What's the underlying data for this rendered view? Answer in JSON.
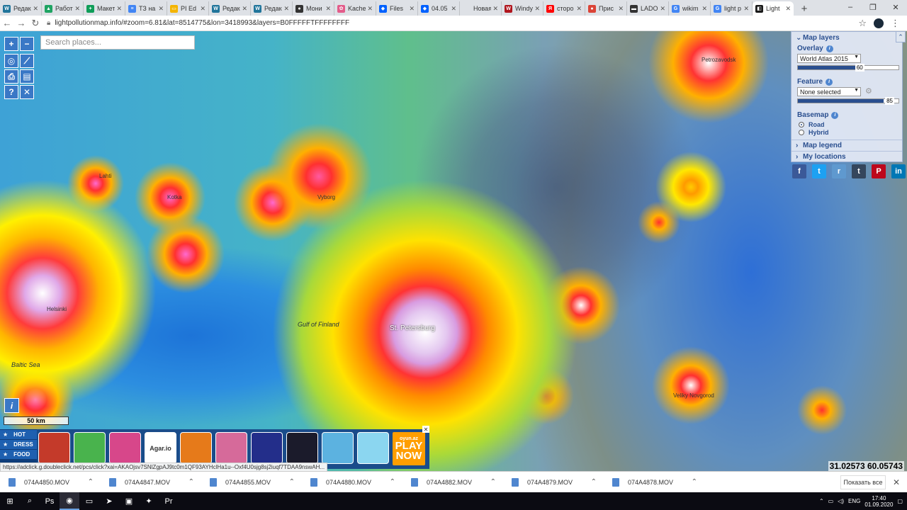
{
  "browser": {
    "tabs": [
      {
        "title": "Редак",
        "icon": "wordpress-icon",
        "color": "#21759b",
        "glyph": "W"
      },
      {
        "title": "Работ",
        "icon": "google-drive-icon",
        "color": "#1fa463",
        "glyph": "▲"
      },
      {
        "title": "Макет",
        "icon": "google-sheets-icon",
        "color": "#0f9d58",
        "glyph": "+"
      },
      {
        "title": "ТЗ на",
        "icon": "google-docs-icon",
        "color": "#4285f4",
        "glyph": "≡"
      },
      {
        "title": "PI Ed",
        "icon": "google-slides-icon",
        "color": "#f4b400",
        "glyph": "▭"
      },
      {
        "title": "Редак",
        "icon": "wordpress-icon",
        "color": "#21759b",
        "glyph": "W"
      },
      {
        "title": "Редак",
        "icon": "wordpress-icon",
        "color": "#21759b",
        "glyph": "W"
      },
      {
        "title": "Мони",
        "icon": "github-icon",
        "color": "#333333",
        "glyph": "●"
      },
      {
        "title": "Kache",
        "icon": "kache-icon",
        "color": "#e35c8a",
        "glyph": "✿"
      },
      {
        "title": "Files",
        "icon": "dropbox-icon",
        "color": "#0061ff",
        "glyph": "◆"
      },
      {
        "title": "04.05",
        "icon": "dropbox-icon",
        "color": "#0061ff",
        "glyph": "◆"
      },
      {
        "title": "Новая вкл",
        "icon": "blank-tab-icon",
        "color": "#dee1e6",
        "glyph": ""
      },
      {
        "title": "Windy",
        "icon": "windy-icon",
        "color": "#b0161e",
        "glyph": "W"
      },
      {
        "title": "сторо",
        "icon": "yandex-icon",
        "color": "#ff0000",
        "glyph": "Я"
      },
      {
        "title": "Прис",
        "icon": "maps-pin-icon",
        "color": "#db4437",
        "glyph": "●"
      },
      {
        "title": "LADO",
        "icon": "car-icon",
        "color": "#333333",
        "glyph": "▬"
      },
      {
        "title": "wikim",
        "icon": "google-icon",
        "color": "#4285f4",
        "glyph": "G"
      },
      {
        "title": "light p",
        "icon": "google-icon",
        "color": "#4285f4",
        "glyph": "G"
      },
      {
        "title": "Light",
        "icon": "lightpollution-icon",
        "color": "#1a1a1a",
        "glyph": "◧",
        "active": true
      }
    ],
    "url": "lightpollutionmap.info/#zoom=6.81&lat=8514775&lon=3418993&layers=B0FFFFFTFFFFFFFF",
    "window_controls": [
      "–",
      "❐",
      "✕"
    ]
  },
  "map": {
    "search_placeholder": "Search places...",
    "controls": [
      {
        "name": "zoom-in-button",
        "glyph": "+"
      },
      {
        "name": "zoom-out-button",
        "glyph": "−"
      },
      {
        "name": "locate-button",
        "glyph": "◎"
      },
      {
        "name": "measure-button",
        "glyph": "⟋"
      },
      {
        "name": "print-button",
        "glyph": "⎙"
      },
      {
        "name": "chart-button",
        "glyph": "▤"
      },
      {
        "name": "help-button",
        "glyph": "?"
      },
      {
        "name": "tools-button",
        "glyph": "✕"
      }
    ],
    "labels": [
      {
        "text": "St. Petersburg",
        "kind": "big"
      },
      {
        "text": "Helsinki",
        "kind": "city"
      },
      {
        "text": "Baltic Sea",
        "kind": "sea"
      },
      {
        "text": "Gulf of Finland",
        "kind": "sea"
      },
      {
        "text": "Vyborg",
        "kind": "city"
      },
      {
        "text": "Kotka",
        "kind": "city"
      },
      {
        "text": "Lahti",
        "kind": "city"
      },
      {
        "text": "Veliky Novgorod",
        "kind": "city"
      },
      {
        "text": "Petrozavodsk",
        "kind": "city"
      }
    ],
    "scale": "50 km",
    "coordinates": "31.02573  60.05743"
  },
  "layers_panel": {
    "title": "Map layers",
    "overlay_label": "Overlay",
    "overlay_value": "World Atlas 2015",
    "overlay_opacity": 60,
    "feature_label": "Feature",
    "feature_value": "None selected",
    "feature_opacity": 85,
    "basemap_label": "Basemap",
    "basemap_options": [
      "Road",
      "Hybrid"
    ],
    "basemap_selected": "Road",
    "map_legend": "Map legend",
    "my_locations": "My locations",
    "social": [
      {
        "name": "facebook-icon",
        "glyph": "f",
        "color": "#3b5998"
      },
      {
        "name": "twitter-icon",
        "glyph": "t",
        "color": "#1da1f2"
      },
      {
        "name": "reddit-icon",
        "glyph": "r",
        "color": "#5f99cf"
      },
      {
        "name": "tumblr-icon",
        "glyph": "t",
        "color": "#35465c"
      },
      {
        "name": "pinterest-icon",
        "glyph": "P",
        "color": "#bd081c"
      },
      {
        "name": "linkedin-icon",
        "glyph": "in",
        "color": "#0077b5"
      }
    ]
  },
  "ad": {
    "categories": [
      "HOT",
      "DRESS",
      "FOOD"
    ],
    "category_icons": [
      "★",
      "★",
      "★"
    ],
    "games": [
      {
        "label": "",
        "color": "#c43a2a"
      },
      {
        "label": "",
        "color": "#49b34d"
      },
      {
        "label": "",
        "color": "#d7478a"
      },
      {
        "label": "Agar.io",
        "color": "#ffffff"
      },
      {
        "label": "",
        "color": "#e67a1a"
      },
      {
        "label": "",
        "color": "#d66a9a"
      },
      {
        "label": "",
        "color": "#232e8a"
      },
      {
        "label": "",
        "color": "#1b1b2b"
      },
      {
        "label": "",
        "color": "#5cb2e0"
      },
      {
        "label": "",
        "color": "#8bd6f0"
      }
    ],
    "play_brand": "oyun.az",
    "play_text": "PLAY NOW",
    "close": "✕"
  },
  "status_url": "https://adclick.g.doubleclick.net/pcs/click?xai=AKAOjsv7SNlZgpAJ9tc0m1QF93AYHclHa1u--Oxf4U0sjg8sj2iuqf7TDAA9nswAH...",
  "downloads": {
    "items": [
      "074A4850.MOV",
      "074A4847.MOV",
      "074A4855.MOV",
      "074A4880.MOV",
      "074A4882.MOV",
      "074A4879.MOV",
      "074A4878.MOV"
    ],
    "show_all": "Показать все"
  },
  "taskbar": {
    "apps": [
      {
        "name": "windows-start-icon",
        "glyph": "⊞"
      },
      {
        "name": "search-icon",
        "glyph": "⌕"
      },
      {
        "name": "photoshop-icon",
        "glyph": "Ps"
      },
      {
        "name": "chrome-icon",
        "glyph": "◉"
      },
      {
        "name": "explorer-icon",
        "glyph": "▭"
      },
      {
        "name": "telegram-icon",
        "glyph": "➤"
      },
      {
        "name": "app-icon",
        "glyph": "▣"
      },
      {
        "name": "app2-icon",
        "glyph": "✦"
      },
      {
        "name": "premiere-icon",
        "glyph": "Pr"
      }
    ],
    "lang": "ENG",
    "time": "17:40",
    "date": "01.09.2020"
  }
}
